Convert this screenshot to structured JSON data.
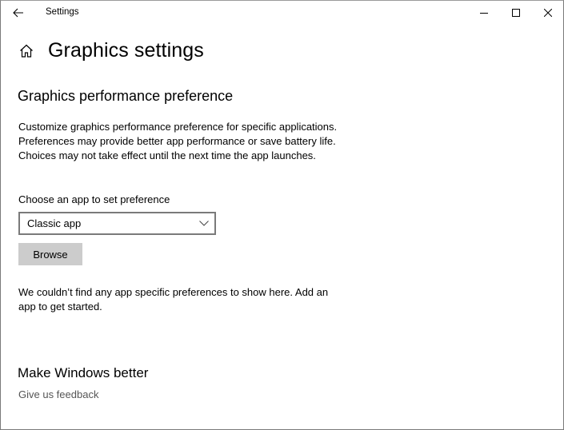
{
  "window": {
    "title": "Settings",
    "controls": {
      "back": "back-arrow-icon",
      "minimize": "minimize-icon",
      "maximize": "maximize-icon",
      "close": "close-icon"
    }
  },
  "header": {
    "home_icon": "home-icon",
    "title": "Graphics settings"
  },
  "graphics_preference": {
    "section_title": "Graphics performance preference",
    "description": "Customize graphics performance preference for specific applications. Preferences may provide better app performance or save battery life. Choices may not take effect until the next time the app launches.",
    "choose_label": "Choose an app to set preference",
    "app_type_dropdown": {
      "selected": "Classic app"
    },
    "browse_label": "Browse",
    "empty_message": "We couldn’t find any app specific preferences to show here. Add an app to get started."
  },
  "make_windows_better": {
    "title": "Make Windows better",
    "feedback_link": "Give us feedback"
  },
  "colors": {
    "button_bg": "#cccccc",
    "dropdown_border": "#7a7a7a",
    "link_text": "#555555"
  }
}
